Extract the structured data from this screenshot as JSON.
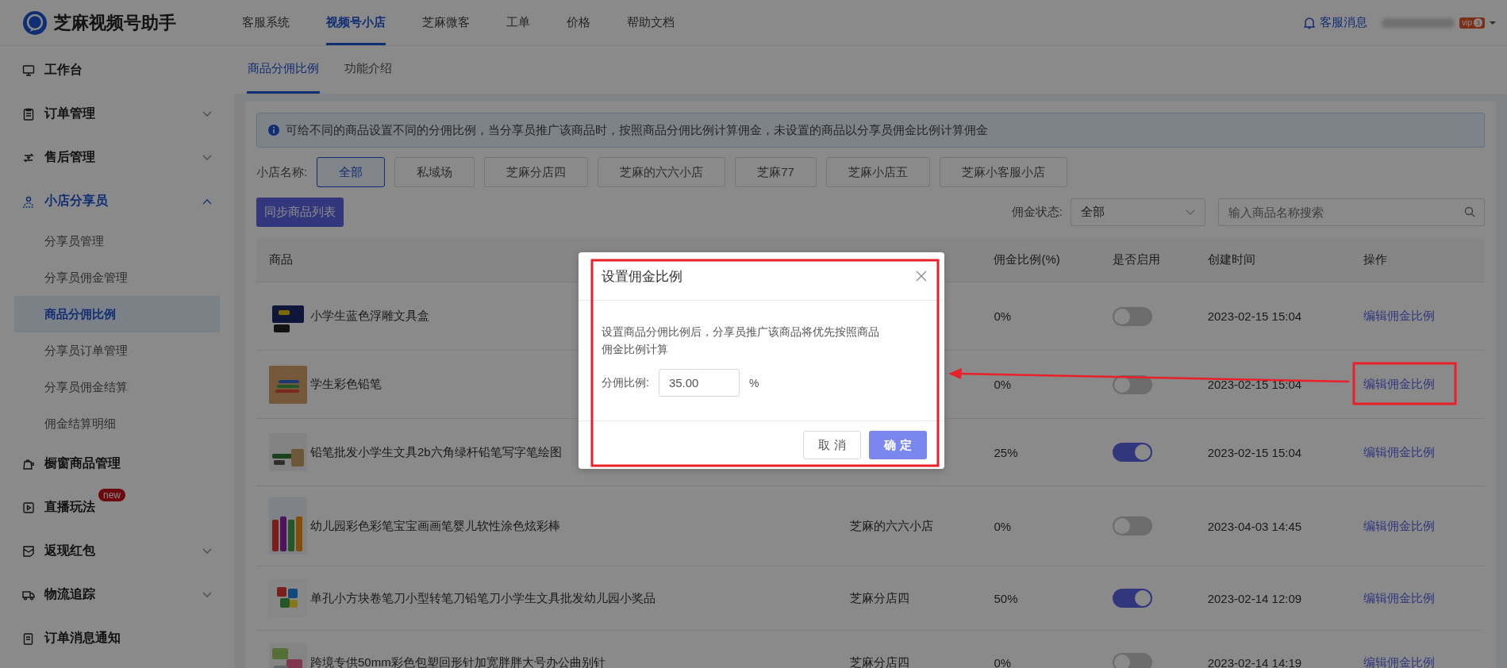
{
  "app": {
    "name": "芝麻视频号助手"
  },
  "top_nav": [
    {
      "label": "客服系统",
      "selected": false
    },
    {
      "label": "视频号小店",
      "selected": true
    },
    {
      "label": "芝麻微客",
      "selected": false
    },
    {
      "label": "工单",
      "selected": false
    },
    {
      "label": "价格",
      "selected": false
    },
    {
      "label": "帮助文档",
      "selected": false
    }
  ],
  "user_area": {
    "messages": "客服消息",
    "vip_label": "vip",
    "vip_level": "3"
  },
  "sidebar": {
    "items": [
      {
        "label": "工作台",
        "selected": false
      },
      {
        "label": "订单管理",
        "selected": false,
        "expanded": false
      },
      {
        "label": "售后管理",
        "selected": false,
        "expanded": false
      },
      {
        "label": "小店分享员",
        "selected": true,
        "expanded": true,
        "children": [
          {
            "label": "分享员管理",
            "selected": false
          },
          {
            "label": "分享员佣金管理",
            "selected": false
          },
          {
            "label": "商品分佣比例",
            "selected": true
          },
          {
            "label": "分享员订单管理",
            "selected": false
          },
          {
            "label": "分享员佣金结算",
            "selected": false
          },
          {
            "label": "佣金结算明细",
            "selected": false
          }
        ]
      },
      {
        "label": "橱窗商品管理",
        "selected": false
      },
      {
        "label": "直播玩法",
        "selected": false,
        "badge": "new"
      },
      {
        "label": "返现红包",
        "selected": false,
        "expanded": false
      },
      {
        "label": "物流追踪",
        "selected": false,
        "expanded": false
      },
      {
        "label": "订单消息通知",
        "selected": false
      }
    ]
  },
  "tabs": [
    {
      "label": "商品分佣比例",
      "selected": true
    },
    {
      "label": "功能介绍",
      "selected": false
    }
  ],
  "notice": "可给不同的商品设置不同的分佣比例，当分享员推广该商品时，按照商品分佣比例计算佣金，未设置的商品以分享员佣金比例计算佣金",
  "shop_filter": {
    "label": "小店名称:",
    "options": [
      {
        "label": "全部",
        "selected": true
      },
      {
        "label": "私域场",
        "selected": false
      },
      {
        "label": "芝麻分店四",
        "selected": false
      },
      {
        "label": "芝麻的六六小店",
        "selected": false
      },
      {
        "label": "芝麻77",
        "selected": false
      },
      {
        "label": "芝麻小店五",
        "selected": false
      },
      {
        "label": "芝麻小客服小店",
        "selected": false
      }
    ]
  },
  "sync_button": "同步商品列表",
  "status_filter": {
    "label": "佣金状态:",
    "value": "全部"
  },
  "search": {
    "placeholder": "输入商品名称搜索"
  },
  "table": {
    "columns": [
      "商品",
      "佣金比例(%)",
      "是否启用",
      "创建时间",
      "操作"
    ],
    "rows": [
      {
        "product": "小学生蓝色浮雕文具盒",
        "ratio": "0%",
        "enabled": false,
        "created": "2023-02-15 15:04",
        "action": "编辑佣金比例"
      },
      {
        "product": "学生彩色铅笔",
        "ratio": "0%",
        "enabled": false,
        "created": "2023-02-15 15:04",
        "action": "编辑佣金比例"
      },
      {
        "product": "铅笔批发小学生文具2b六角绿杆铅笔写字笔绘图",
        "ratio": "25%",
        "enabled": true,
        "created": "2023-02-15 15:04",
        "action": "编辑佣金比例"
      },
      {
        "product": "幼儿园彩色彩笔宝宝画画笔婴儿软性涂色炫彩棒",
        "shop": "芝麻的六六小店",
        "ratio": "0%",
        "enabled": false,
        "created": "2023-04-03 14:45",
        "action": "编辑佣金比例"
      },
      {
        "product": "单孔小方块卷笔刀小型转笔刀铅笔刀小学生文具批发幼儿园小奖品",
        "shop": "芝麻分店四",
        "ratio": "50%",
        "enabled": true,
        "created": "2023-02-14 12:09",
        "action": "编辑佣金比例"
      },
      {
        "product": "跨境专供50mm彩色包塑回形针加宽胖胖大号办公曲别针",
        "shop": "芝麻分店四",
        "ratio": "0%",
        "enabled": false,
        "created": "2023-02-14 14:19",
        "action": "编辑佣金比例"
      }
    ]
  },
  "dialog": {
    "title": "设置佣金比例",
    "description": "设置商品分佣比例后，分享员推广该商品将优先按照商品佣金比例计算",
    "field_label": "分佣比例:",
    "value": "35.00",
    "unit": "%",
    "buttons": [
      "取 消",
      "确 定"
    ]
  }
}
